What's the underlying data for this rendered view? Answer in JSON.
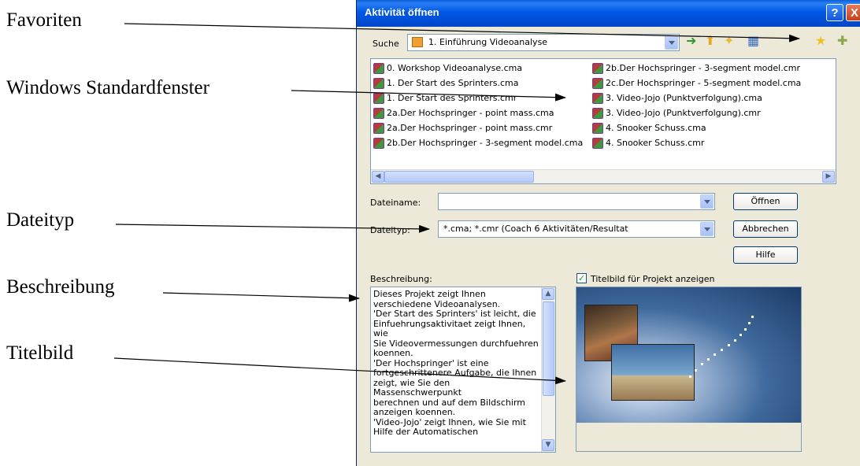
{
  "annotations": {
    "favoriten": "Favoriten",
    "windows": "Windows Standardfenster",
    "dateityp": "Dateityp",
    "beschreibung": "Beschreibung",
    "titelbild": "Titelbild"
  },
  "dialog": {
    "title": "Aktivität öffnen",
    "help_button": "?",
    "close_button": "X",
    "search_label": "Suche",
    "search_value": "1. Einführung Videoanalyse",
    "toolbar_icons": [
      "back-icon",
      "up-folder-icon",
      "new-folder-icon",
      "view-menu-icon",
      "favorites-icon",
      "add-favorite-icon"
    ],
    "files_left": [
      "0. Workshop Videoanalyse.cma",
      "1. Der Start des Sprinters.cma",
      "1. Der Start des Sprinters.cmr",
      "2a.Der Hochspringer - point mass.cma",
      "2a.Der Hochspringer - point mass.cmr",
      "2b.Der Hochspringer - 3-segment model.cma"
    ],
    "files_right": [
      "2b.Der Hochspringer - 3-segment model.cmr",
      "2c.Der Hochspringer - 5-segment model.cma",
      "3. Video-Jojo (Punktverfolgung).cma",
      "3. Video-Jojo (Punktverfolgung).cmr",
      "4. Snooker Schuss.cma",
      "4. Snooker Schuss.cmr"
    ],
    "filename_label": "Dateiname:",
    "filename_value": "",
    "filetype_label": "Dateityp:",
    "filetype_value": "*.cma; *.cmr (Coach 6 Aktivitäten/Resultat",
    "open_button": "Öffnen",
    "cancel_button": "Abbrechen",
    "help_button_label": "Hilfe",
    "description_label": "Beschreibung:",
    "description_lines": [
      "Dieses Projekt zeigt Ihnen",
      "verschiedene Videoanalysen.",
      "'Der Start des Sprinters' ist leicht, die",
      "Einfuehrungsaktivitaet zeigt Ihnen, wie",
      "Sie Videovermessungen durchfuehren",
      "koennen.",
      "'Der Hochspringer' ist eine",
      "fortgeschrittenere Aufgabe, die Ihnen",
      "zeigt, wie Sie den Massenschwerpunkt",
      "berechnen und auf dem Bildschirm",
      "anzeigen koennen.",
      "'Video-Jojo' zeigt Ihnen, wie Sie mit",
      "Hilfe der Automatischen"
    ],
    "show_title_image_label": "Titelbild für Projekt anzeigen",
    "show_title_image_checked": true
  }
}
